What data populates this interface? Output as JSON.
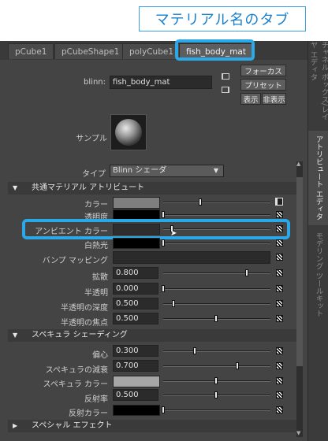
{
  "callout": {
    "text": "マテリアル名のタブ"
  },
  "tabs": [
    {
      "label": "pCube1"
    },
    {
      "label": "pCubeShape1"
    },
    {
      "label": "polyCube1"
    },
    {
      "label": "fish_body_mat"
    }
  ],
  "header": {
    "node_type_label": "blinn:",
    "node_name": "fish_body_mat",
    "focus_button": "フォーカス",
    "preset_button": "プリセット",
    "show_button": "表示",
    "hide_button": "非表示"
  },
  "sample": {
    "label": "サンプル"
  },
  "type": {
    "label": "タイプ",
    "value": "Blinn シェーダ"
  },
  "sections": {
    "common": "共通マテリアル アトリビュート",
    "specular": "スペキュラ シェーディング",
    "special": "スペシャル エフェクト"
  },
  "common_attrs": {
    "color": "カラー",
    "transparency": "透明度",
    "ambient": "アンビエント カラー",
    "incandescence": "白熱光",
    "bump": "バンプ マッピング",
    "diffuse": "拡散",
    "diffuse_value": "0.800",
    "translucence": "半透明",
    "translucence_value": "0.000",
    "translucence_depth": "半透明の深度",
    "translucence_depth_value": "0.500",
    "translucence_focus": "半透明の焦点",
    "translucence_focus_value": "0.500"
  },
  "specular_attrs": {
    "eccentricity": "偏心",
    "eccentricity_value": "0.300",
    "rolloff": "スペキュラの減衰",
    "rolloff_value": "0.700",
    "spec_color": "スペキュラ カラー",
    "reflectivity": "反射率",
    "reflectivity_value": "0.500",
    "reflected_color": "反射カラー"
  },
  "right_tabs": {
    "channel_box": "チャネル ボックス/レイヤ エディタ",
    "attribute_editor": "アトリビュート エディタ",
    "modeling_toolkit": "モデリング ツールキット"
  },
  "colors": {
    "highlight": "#2aa8e8",
    "callout_text": "#1a7fc9"
  }
}
